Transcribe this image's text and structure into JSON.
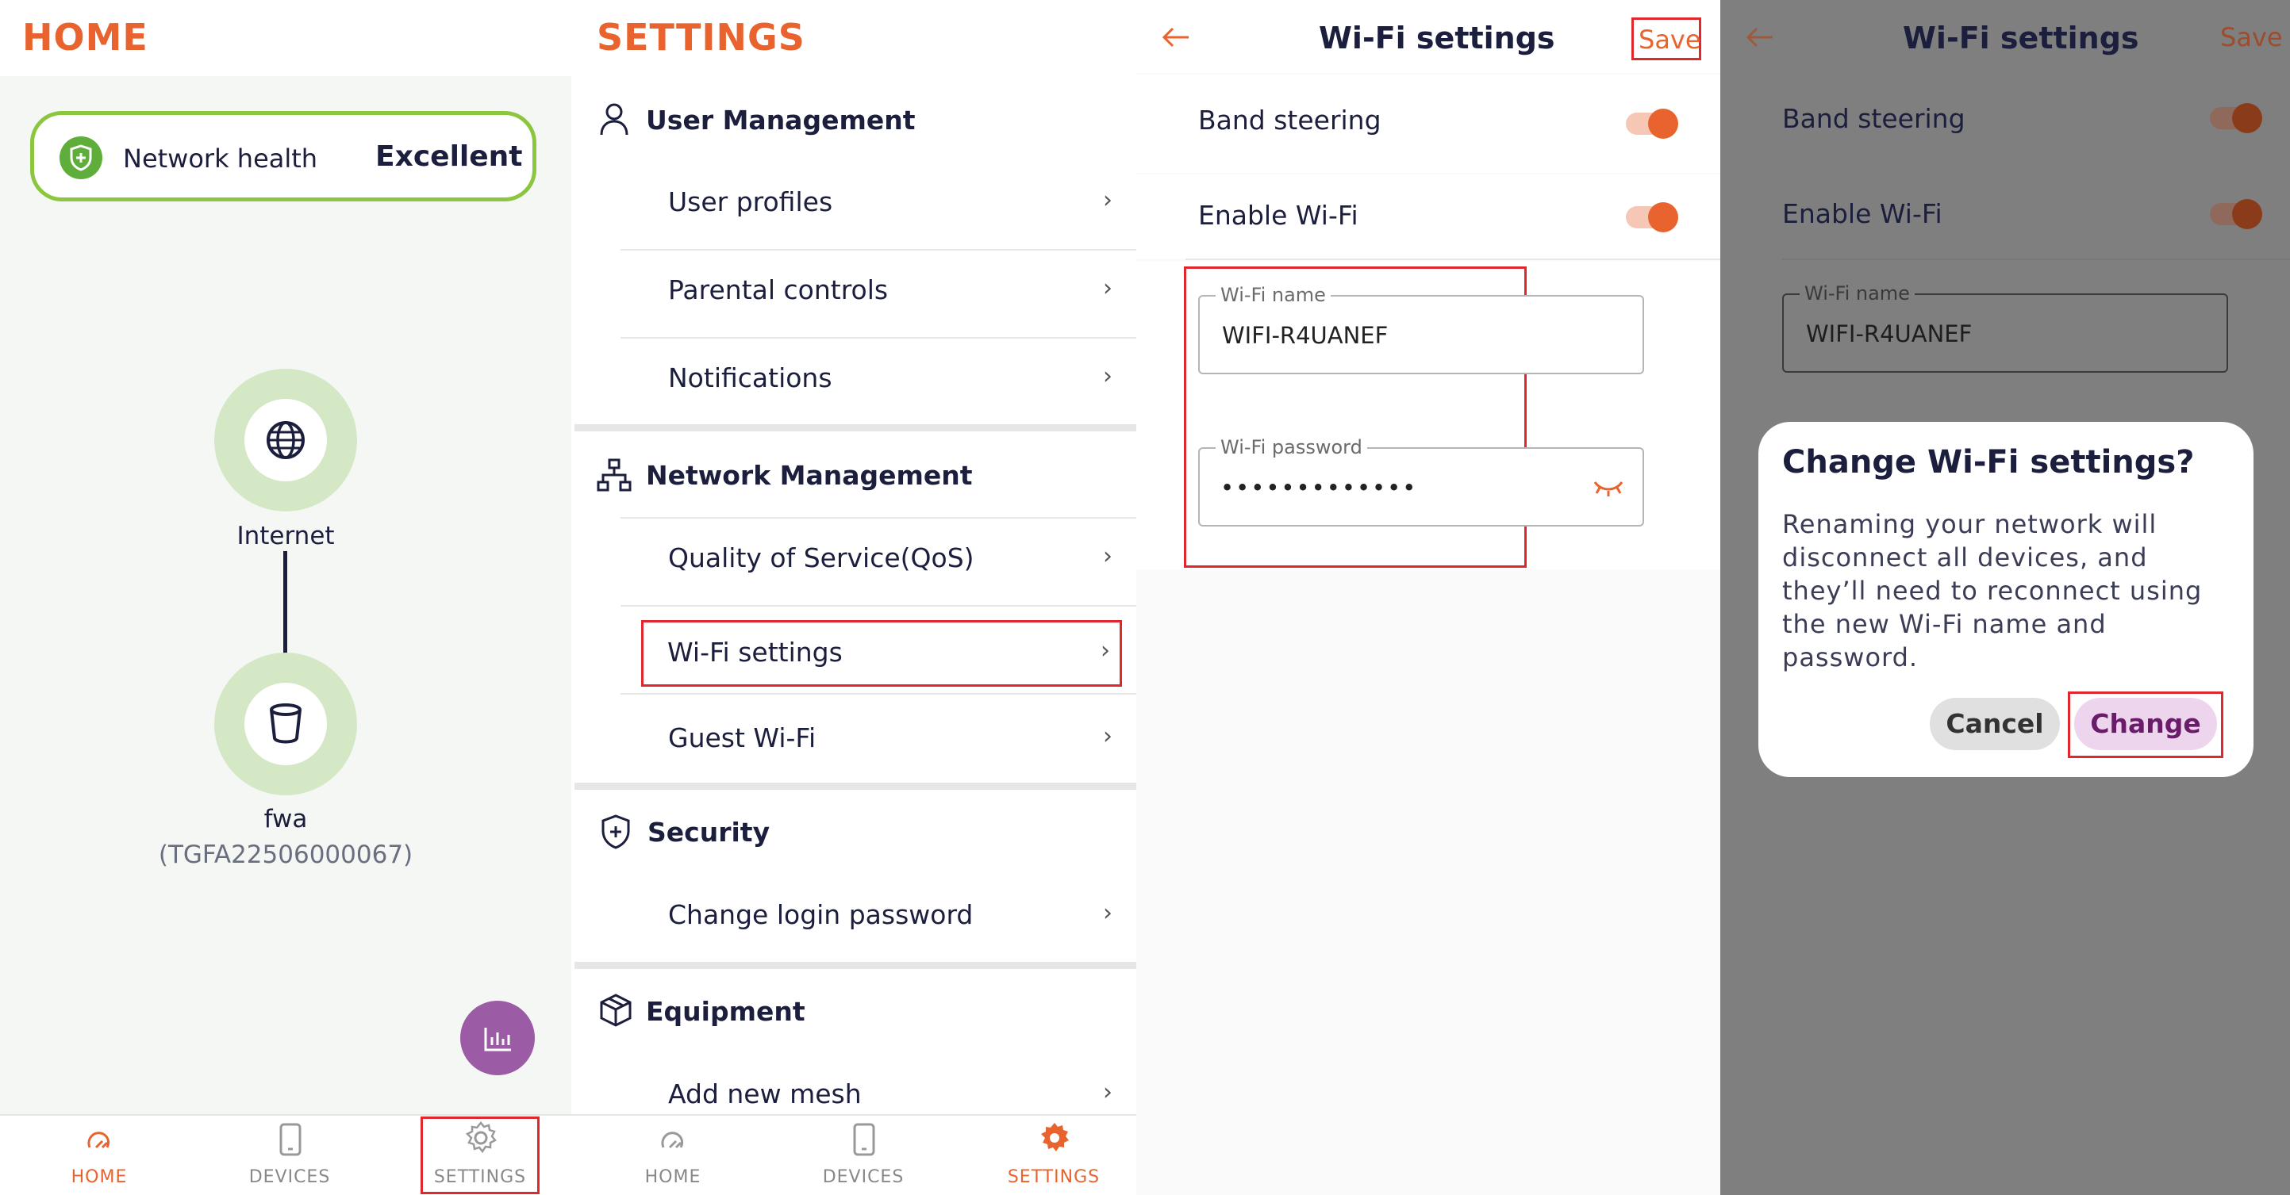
{
  "panel1": {
    "title": "HOME",
    "health_label": "Network health",
    "health_value": "Excellent",
    "internet_label": "Internet",
    "device_name": "fwa",
    "device_id": "(TGFA22506000067)",
    "tabs": [
      {
        "label": "HOME",
        "icon": "home-icon",
        "active": true
      },
      {
        "label": "DEVICES",
        "icon": "devices-icon",
        "active": false
      },
      {
        "label": "SETTINGS",
        "icon": "gear-icon",
        "active": false
      }
    ]
  },
  "panel2": {
    "title": "SETTINGS",
    "sections": {
      "user_management": "User Management",
      "network_management": "Network Management",
      "security": "Security",
      "equipment": "Equipment"
    },
    "items": {
      "user_profiles": "User profiles",
      "parental_controls": "Parental controls",
      "notifications": "Notifications",
      "qos": "Quality of Service(QoS)",
      "wifi_settings": "Wi-Fi settings",
      "guest_wifi": "Guest Wi-Fi",
      "change_login_password": "Change login password",
      "add_new_mesh": "Add new mesh"
    },
    "tabs": [
      {
        "label": "HOME",
        "icon": "home-icon",
        "active": false
      },
      {
        "label": "DEVICES",
        "icon": "devices-icon",
        "active": false
      },
      {
        "label": "SETTINGS",
        "icon": "gear-icon",
        "active": true
      }
    ]
  },
  "panel3": {
    "title": "Wi-Fi settings",
    "save_label": "Save",
    "band_steering_label": "Band steering",
    "band_steering_on": true,
    "enable_wifi_label": "Enable Wi-Fi",
    "enable_wifi_on": true,
    "wifi_name_label": "Wi-Fi name",
    "wifi_name_value": "WIFI-R4UANEF",
    "wifi_password_label": "Wi-Fi password",
    "wifi_password_value": "•••••••••••••"
  },
  "panel4": {
    "title": "Wi-Fi settings",
    "save_label": "Save",
    "band_steering_label": "Band steering",
    "enable_wifi_label": "Enable Wi-Fi",
    "wifi_name_label": "Wi-Fi name",
    "wifi_name_value": "WIFI-R4UANEF",
    "dialog": {
      "title": "Change Wi-Fi settings?",
      "message": "Renaming your network will disconnect all devices, and they’ll need to reconnect using the new Wi-Fi name and password.",
      "cancel_label": "Cancel",
      "change_label": "Change"
    }
  },
  "colors": {
    "accent": "#e8632d",
    "navy": "#1b1e3c",
    "health_green": "#8cc63f",
    "node_ring": "#d5e8c5",
    "fab_purple": "#9b5ba5",
    "highlight_red": "#e0272b",
    "change_purple": "#6a1b6a"
  }
}
